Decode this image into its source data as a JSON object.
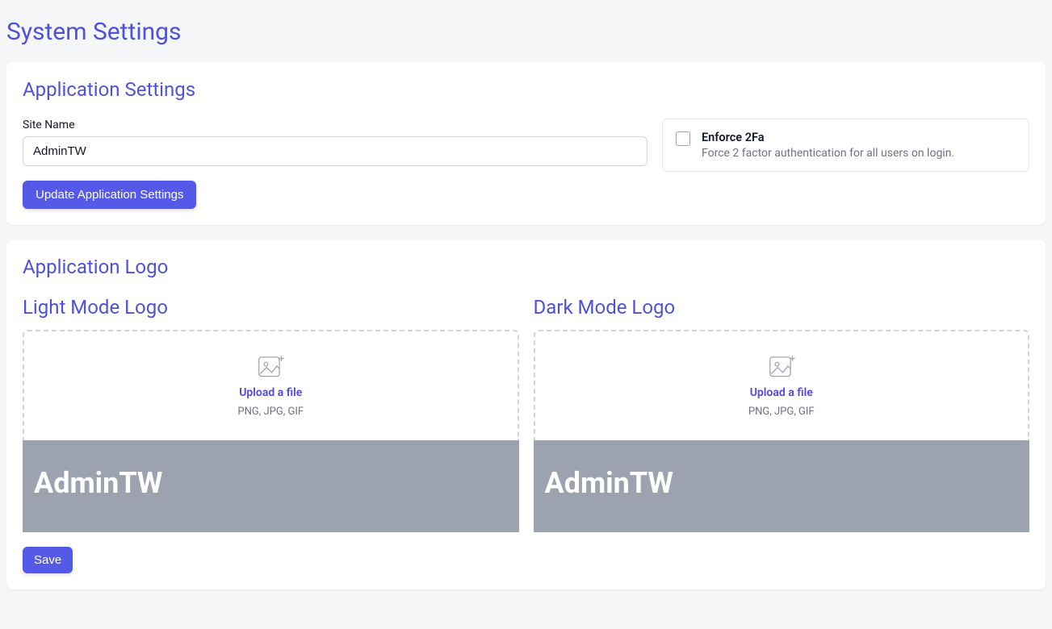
{
  "page_title": "System Settings",
  "app_settings": {
    "section_title": "Application Settings",
    "site_name_label": "Site Name",
    "site_name_value": "AdminTW",
    "update_button_label": "Update Application Settings",
    "enforce_2fa_title": "Enforce 2Fa",
    "enforce_2fa_description": "Force 2 factor authentication for all users on login.",
    "enforce_2fa_checked": false
  },
  "app_logo": {
    "section_title": "Application Logo",
    "light": {
      "title": "Light Mode Logo",
      "upload_label": "Upload a file",
      "formats": "PNG, JPG, GIF",
      "preview_text": "AdminTW"
    },
    "dark": {
      "title": "Dark Mode Logo",
      "upload_label": "Upload a file",
      "formats": "PNG, JPG, GIF",
      "preview_text": "AdminTW"
    },
    "save_button_label": "Save"
  }
}
